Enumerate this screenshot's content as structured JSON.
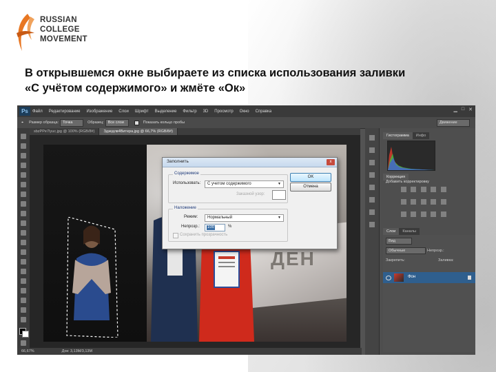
{
  "slide": {
    "logo": {
      "line1": "RUSSIAN",
      "line2": "COLLEGE",
      "line3": "MOVEMENT"
    },
    "heading": {
      "line1": "В открывшемся окне выбираете из списка использования заливки",
      "line2": "«С учётом содержимого» и жмёте «Ок»"
    }
  },
  "photoshop": {
    "app_icon": "Ps",
    "menu": [
      "Файл",
      "Редактирование",
      "Изображение",
      "Слои",
      "Шрифт",
      "Выделение",
      "Фильтр",
      "3D",
      "Просмотр",
      "Окно",
      "Справка"
    ],
    "options": {
      "size_label": "Размер образца:",
      "size_value": "Точка",
      "sample_label": "Образец:",
      "sample_value": "Все слои",
      "show_ring": "Показать кольцо пробы",
      "workspace": "Движение"
    },
    "tabs": [
      {
        "label": "sbzPPe7Iyuc.jpg @ 100% (RGB/8#)"
      },
      {
        "label": "Здзедлв4Витера.jpg @ 66,7% (RGB/8#)"
      }
    ],
    "status": {
      "zoom": "66,67%",
      "doc": "Док: 3,13М/3,13М"
    },
    "screen_text": "ДЕН",
    "panels": {
      "tab_histogram": "Гистограмма",
      "tab_info": "Инфо",
      "tab_corrections": "Коррекция",
      "add_correction": "Добавить корректировку",
      "tab_layers": "Слои",
      "tab_channels": "Каналы",
      "layers_kind": "Вид",
      "blend_mode": "Обычные",
      "opacity_label": "Непрозр.:",
      "lock_label": "Закрепить:",
      "fill_label": "Заливка:",
      "layer_name": "Фон"
    },
    "dialog": {
      "title": "Заполнить",
      "close": "x",
      "contents_group": "Содержимое",
      "use_label": "Использовать:",
      "use_value": "С учетом содержимого",
      "custom_pattern": "Заказной узор:",
      "blending_group": "Наложение",
      "mode_label": "Режим:",
      "mode_value": "Нормальный",
      "opacity_label": "Непрозр.:",
      "opacity_value": "100",
      "percent": "%",
      "preserve_transparency": "Сохранить прозрачность",
      "ok_button": "OK",
      "cancel_button": "Отмена"
    }
  },
  "colors": {
    "ps_bg": "#535353",
    "dialog_bg": "#f0f0f0",
    "layer_selected": "#2f5f8e"
  }
}
